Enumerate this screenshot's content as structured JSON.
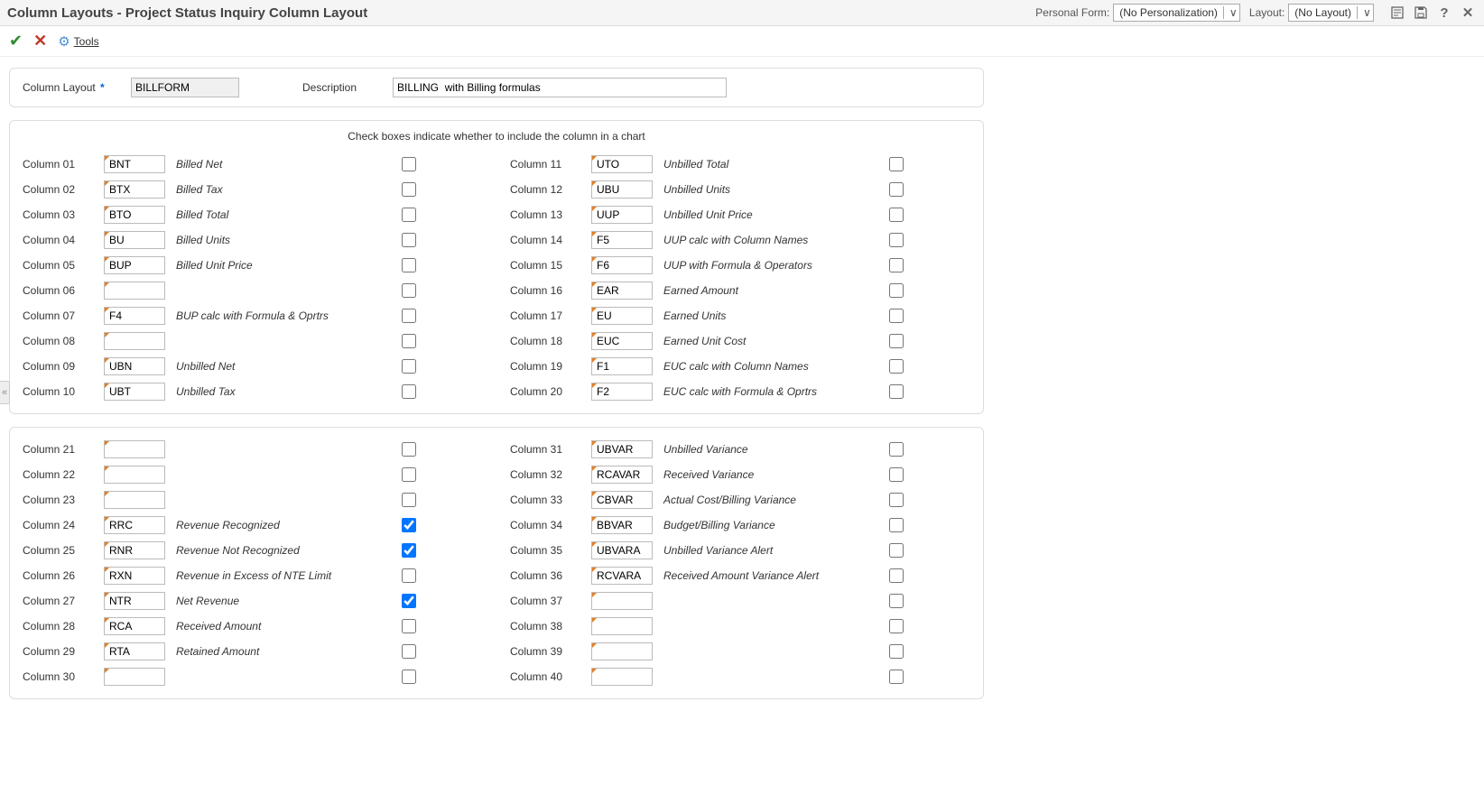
{
  "title": "Column Layouts - Project Status Inquiry Column Layout",
  "personalForm": {
    "label": "Personal Form:",
    "value": "(No Personalization)"
  },
  "layout": {
    "label": "Layout:",
    "value": "(No Layout)"
  },
  "toolbar": {
    "tools": "Tools"
  },
  "header": {
    "columnLayoutLabel": "Column Layout",
    "columnLayoutValue": "BILLFORM",
    "descriptionLabel": "Description",
    "descriptionValue": "BILLING  with Billing formulas"
  },
  "hint": "Check boxes indicate whether to include the column in a chart",
  "group1": {
    "left": [
      {
        "label": "Column 01",
        "code": "BNT",
        "desc": "Billed Net",
        "checked": false
      },
      {
        "label": "Column 02",
        "code": "BTX",
        "desc": "Billed Tax",
        "checked": false
      },
      {
        "label": "Column 03",
        "code": "BTO",
        "desc": "Billed Total",
        "checked": false
      },
      {
        "label": "Column 04",
        "code": "BU",
        "desc": "Billed Units",
        "checked": false
      },
      {
        "label": "Column 05",
        "code": "BUP",
        "desc": "Billed Unit Price",
        "checked": false
      },
      {
        "label": "Column 06",
        "code": "",
        "desc": "",
        "checked": false
      },
      {
        "label": "Column 07",
        "code": "F4",
        "desc": "BUP calc with Formula & Oprtrs",
        "checked": false
      },
      {
        "label": "Column 08",
        "code": "",
        "desc": "",
        "checked": false
      },
      {
        "label": "Column 09",
        "code": "UBN",
        "desc": "Unbilled Net",
        "checked": false
      },
      {
        "label": "Column 10",
        "code": "UBT",
        "desc": "Unbilled Tax",
        "checked": false
      }
    ],
    "right": [
      {
        "label": "Column 11",
        "code": "UTO",
        "desc": "Unbilled Total",
        "checked": false
      },
      {
        "label": "Column 12",
        "code": "UBU",
        "desc": "Unbilled Units",
        "checked": false
      },
      {
        "label": "Column 13",
        "code": "UUP",
        "desc": "Unbilled Unit Price",
        "checked": false
      },
      {
        "label": "Column 14",
        "code": "F5",
        "desc": "UUP calc with Column Names",
        "checked": false
      },
      {
        "label": "Column 15",
        "code": "F6",
        "desc": "UUP with Formula & Operators",
        "checked": false
      },
      {
        "label": "Column 16",
        "code": "EAR",
        "desc": "Earned Amount",
        "checked": false
      },
      {
        "label": "Column 17",
        "code": "EU",
        "desc": "Earned Units",
        "checked": false
      },
      {
        "label": "Column 18",
        "code": "EUC",
        "desc": "Earned Unit Cost",
        "checked": false
      },
      {
        "label": "Column 19",
        "code": "F1",
        "desc": "EUC calc with Column Names",
        "checked": false
      },
      {
        "label": "Column 20",
        "code": "F2",
        "desc": "EUC calc with Formula & Oprtrs",
        "checked": false
      }
    ]
  },
  "group2": {
    "left": [
      {
        "label": "Column 21",
        "code": "",
        "desc": "",
        "checked": false
      },
      {
        "label": "Column 22",
        "code": "",
        "desc": "",
        "checked": false
      },
      {
        "label": "Column 23",
        "code": "",
        "desc": "",
        "checked": false
      },
      {
        "label": "Column 24",
        "code": "RRC",
        "desc": "Revenue Recognized",
        "checked": true
      },
      {
        "label": "Column 25",
        "code": "RNR",
        "desc": "Revenue Not Recognized",
        "checked": true
      },
      {
        "label": "Column 26",
        "code": "RXN",
        "desc": "Revenue in Excess of NTE Limit",
        "checked": false
      },
      {
        "label": "Column 27",
        "code": "NTR",
        "desc": "Net Revenue",
        "checked": true
      },
      {
        "label": "Column 28",
        "code": "RCA",
        "desc": "Received Amount",
        "checked": false
      },
      {
        "label": "Column 29",
        "code": "RTA",
        "desc": "Retained Amount",
        "checked": false
      },
      {
        "label": "Column 30",
        "code": "",
        "desc": "",
        "checked": false
      }
    ],
    "right": [
      {
        "label": "Column 31",
        "code": "UBVAR",
        "desc": "Unbilled Variance",
        "checked": false
      },
      {
        "label": "Column 32",
        "code": "RCAVAR",
        "desc": "Received Variance",
        "checked": false
      },
      {
        "label": "Column 33",
        "code": "CBVAR",
        "desc": "Actual Cost/Billing Variance",
        "checked": false
      },
      {
        "label": "Column 34",
        "code": "BBVAR",
        "desc": "Budget/Billing Variance",
        "checked": false
      },
      {
        "label": "Column 35",
        "code": "UBVARA",
        "desc": "Unbilled Variance Alert",
        "checked": false
      },
      {
        "label": "Column 36",
        "code": "RCVARA",
        "desc": "Received Amount Variance Alert",
        "checked": false
      },
      {
        "label": "Column 37",
        "code": "",
        "desc": "",
        "checked": false
      },
      {
        "label": "Column 38",
        "code": "",
        "desc": "",
        "checked": false
      },
      {
        "label": "Column 39",
        "code": "",
        "desc": "",
        "checked": false
      },
      {
        "label": "Column 40",
        "code": "",
        "desc": "",
        "checked": false
      }
    ]
  }
}
